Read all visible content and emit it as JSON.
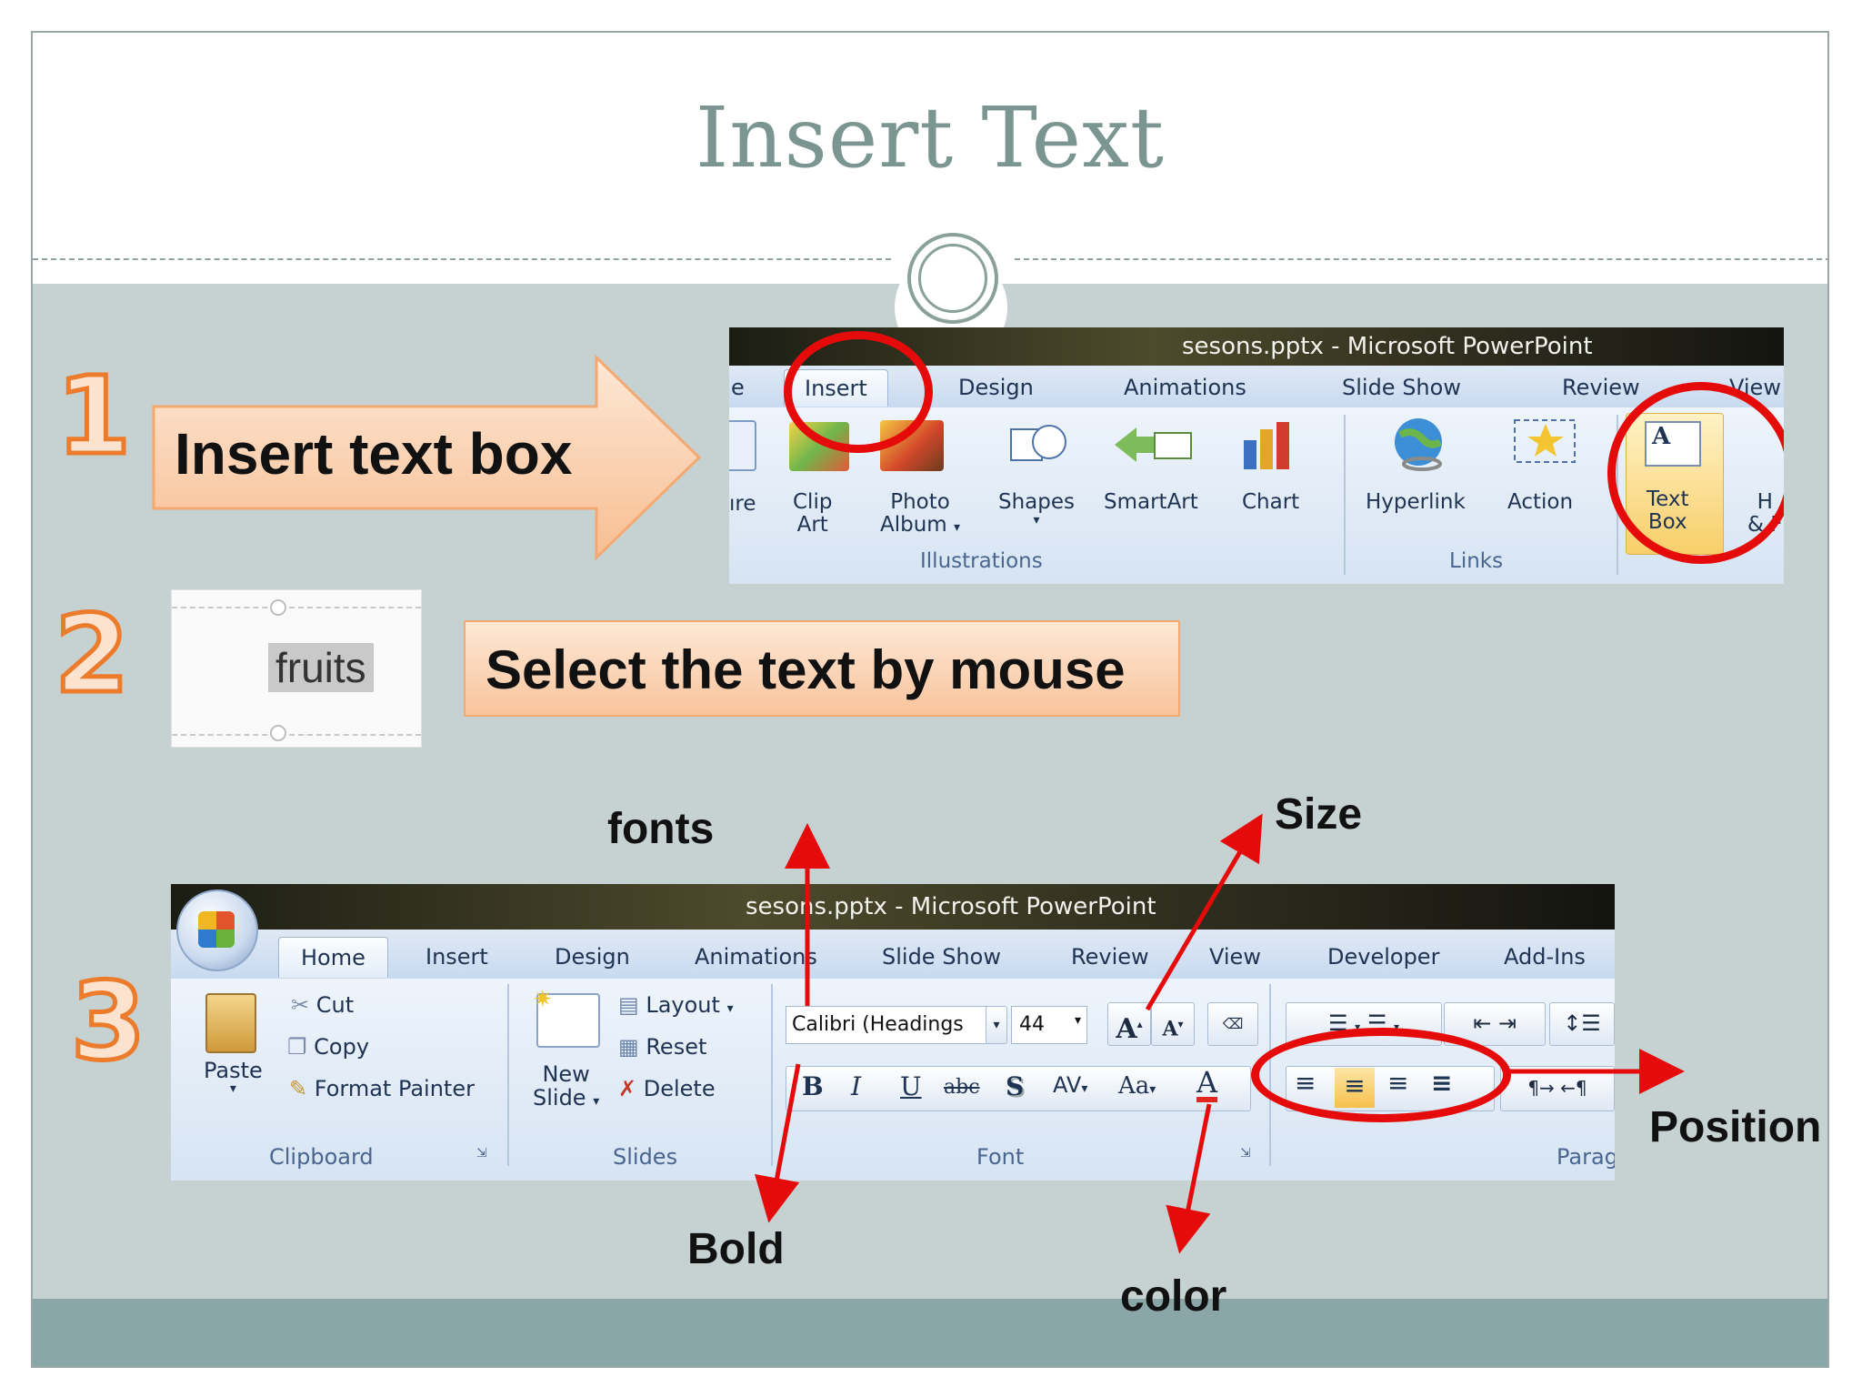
{
  "slide": {
    "title": "Insert Text",
    "colors": {
      "title": "#7b9690",
      "accent": "#ec7b2c",
      "highlight_circle": "#e60b0b",
      "arrow": "#e60b0b"
    }
  },
  "step1": {
    "number": "1",
    "callout": "Insert text box",
    "window_title": "sesons.pptx - Microsoft PowerPoint",
    "tabs": [
      "Insert",
      "Design",
      "Animations",
      "Slide Show",
      "Review",
      "View"
    ],
    "tab_partial_left": "e",
    "items": {
      "picture_partial": "ıre",
      "clip_art": [
        "Clip",
        "Art"
      ],
      "photo_album": [
        "Photo",
        "Album"
      ],
      "shapes": "Shapes",
      "smartart": "SmartArt",
      "chart": "Chart",
      "hyperlink": "Hyperlink",
      "action": "Action",
      "text_box": [
        "Text",
        "Box"
      ],
      "header_partial": [
        "H",
        "& F"
      ]
    },
    "groups": {
      "illustrations": "Illustrations",
      "links": "Links"
    }
  },
  "step2": {
    "number": "2",
    "sample_text": "fruits",
    "callout": "Select the text by mouse"
  },
  "step3": {
    "number": "3",
    "window_title": "sesons.pptx - Microsoft PowerPoint",
    "tabs": [
      "Home",
      "Insert",
      "Design",
      "Animations",
      "Slide Show",
      "Review",
      "View",
      "Developer",
      "Add-Ins"
    ],
    "clipboard": {
      "paste": "Paste",
      "cut": "Cut",
      "copy": "Copy",
      "format_painter": "Format Painter",
      "group": "Clipboard"
    },
    "slides": {
      "new_slide": [
        "New",
        "Slide"
      ],
      "layout": "Layout",
      "reset": "Reset",
      "delete": "Delete",
      "group": "Slides"
    },
    "font": {
      "name": "Calibri (Headings",
      "size": "44",
      "group": "Font",
      "bold": "B",
      "italic": "I",
      "underline": "U",
      "strike": "abc",
      "shadow": "S",
      "spacing": "AV",
      "case": "Aa",
      "grow": "A",
      "shrink": "A",
      "color": "A"
    },
    "paragraph": {
      "group": "Parag"
    },
    "annotations": {
      "fonts": "fonts",
      "size": "Size",
      "bold": "Bold",
      "color": "color",
      "position": "Position"
    }
  }
}
